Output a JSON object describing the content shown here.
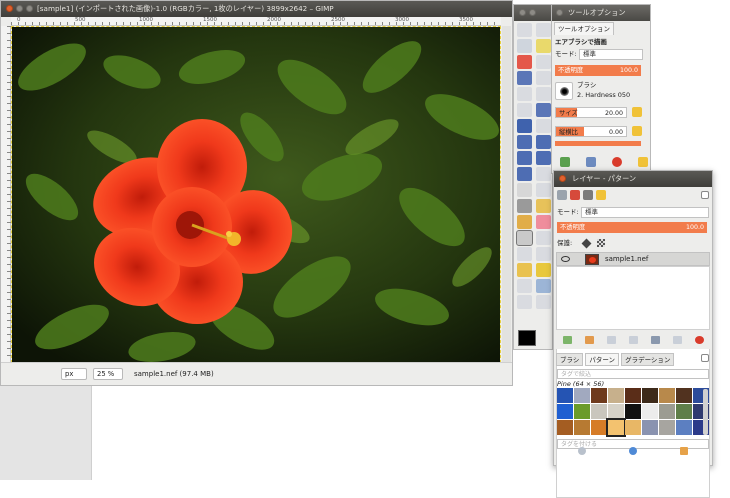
{
  "image_window": {
    "title": "[sample1] (インポートされた画像)-1.0 (RGBカラー, 1枚のレイヤー) 3899x2642 – GIMP",
    "ruler_labels": [
      "0",
      "500",
      "1000",
      "1500",
      "2000",
      "2500",
      "3000",
      "3500"
    ],
    "status": {
      "unit": "px",
      "zoom": "25 %",
      "file": "sample1.nef (97.4 MB)"
    }
  },
  "tool_options": {
    "title": "ツールオプション",
    "tab": "ツールオプション",
    "tool_name": "エアブラシで描画",
    "mode_label": "モード:",
    "mode_value": "標準",
    "opacity_label": "不透明度",
    "opacity_value": "100.0",
    "brush_label": "ブラシ",
    "brush_value": "2. Hardness 050",
    "size_label": "サイズ",
    "size_value": "20.00",
    "aspect_label": "縦横比",
    "aspect_value": "0.00"
  },
  "layers": {
    "title": "レイヤー - パターン",
    "mode_label": "モード:",
    "mode_value": "標準",
    "opacity_label": "不透明度",
    "opacity_value": "100.0",
    "lock_label": "保護:",
    "layer_name": "sample1.nef",
    "tabs": [
      "ブラシ",
      "パターン",
      "グラデーション"
    ],
    "tag_search_placeholder": "タグで絞込",
    "pattern_name": "Pine (64 × 56)",
    "tag_assign_placeholder": "タグを付ける"
  },
  "colors": {
    "accent": "#f27c4b",
    "titlebar": "#4a4945",
    "close": "#e1612f"
  }
}
